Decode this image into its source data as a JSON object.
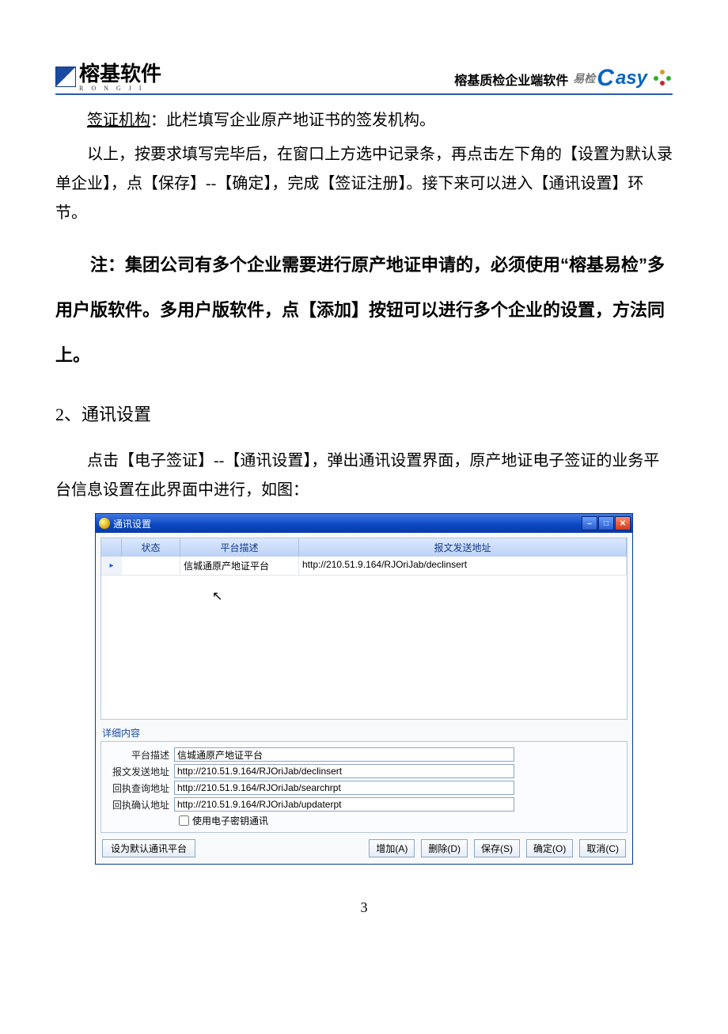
{
  "header": {
    "brand_main": "榕基软件",
    "brand_sub": "R  O  N  G  J  I",
    "right_text": "榕基质检企业端软件",
    "easy_chars": "易检",
    "easy_c": "C",
    "easy_asy": "asy"
  },
  "para1_lead": "签证机构",
  "para1_rest": "：此栏填写企业原产地证书的签发机构。",
  "para2": "以上，按要求填写完毕后，在窗口上方选中记录条，再点击左下角的【设置为默认录单企业】，点【保存】--【确定】，完成【签证注册】。接下来可以进入【通讯设置】环节。",
  "note": "注：集团公司有多个企业需要进行原产地证申请的，必须使用“榕基易检”多用户版软件。多用户版软件，点【添加】按钮可以进行多个企业的设置，方法同上。",
  "h2": "2、通讯设置",
  "para3": "点击【电子签证】--【通讯设置】，弹出通讯设置界面，原产地证电子签证的业务平台信息设置在此界面中进行，如图：",
  "dlg": {
    "title": "通讯设置",
    "cols": {
      "c1": "状态",
      "c2": "平台描述",
      "c3": "报文发送地址"
    },
    "row": {
      "desc": "信城通原产地证平台",
      "send": "http://210.51.9.164/RJOriJab/declinsert"
    },
    "detail_label": "详细内容",
    "labels": {
      "desc": "平台描述",
      "send": "报文发送地址",
      "query": "回执查询地址",
      "confirm": "回执确认地址",
      "chk": "使用电子密钥通讯"
    },
    "values": {
      "desc": "信城通原产地证平台",
      "send": "http://210.51.9.164/RJOriJab/declinsert",
      "query": "http://210.51.9.164/RJOriJab/searchrpt",
      "confirm": "http://210.51.9.164/RJOriJab/updaterpt"
    },
    "buttons": {
      "setdefault": "设为默认通讯平台",
      "add": "增加(A)",
      "del": "删除(D)",
      "save": "保存(S)",
      "ok": "确定(O)",
      "cancel": "取消(C)"
    }
  },
  "page_number": "3"
}
